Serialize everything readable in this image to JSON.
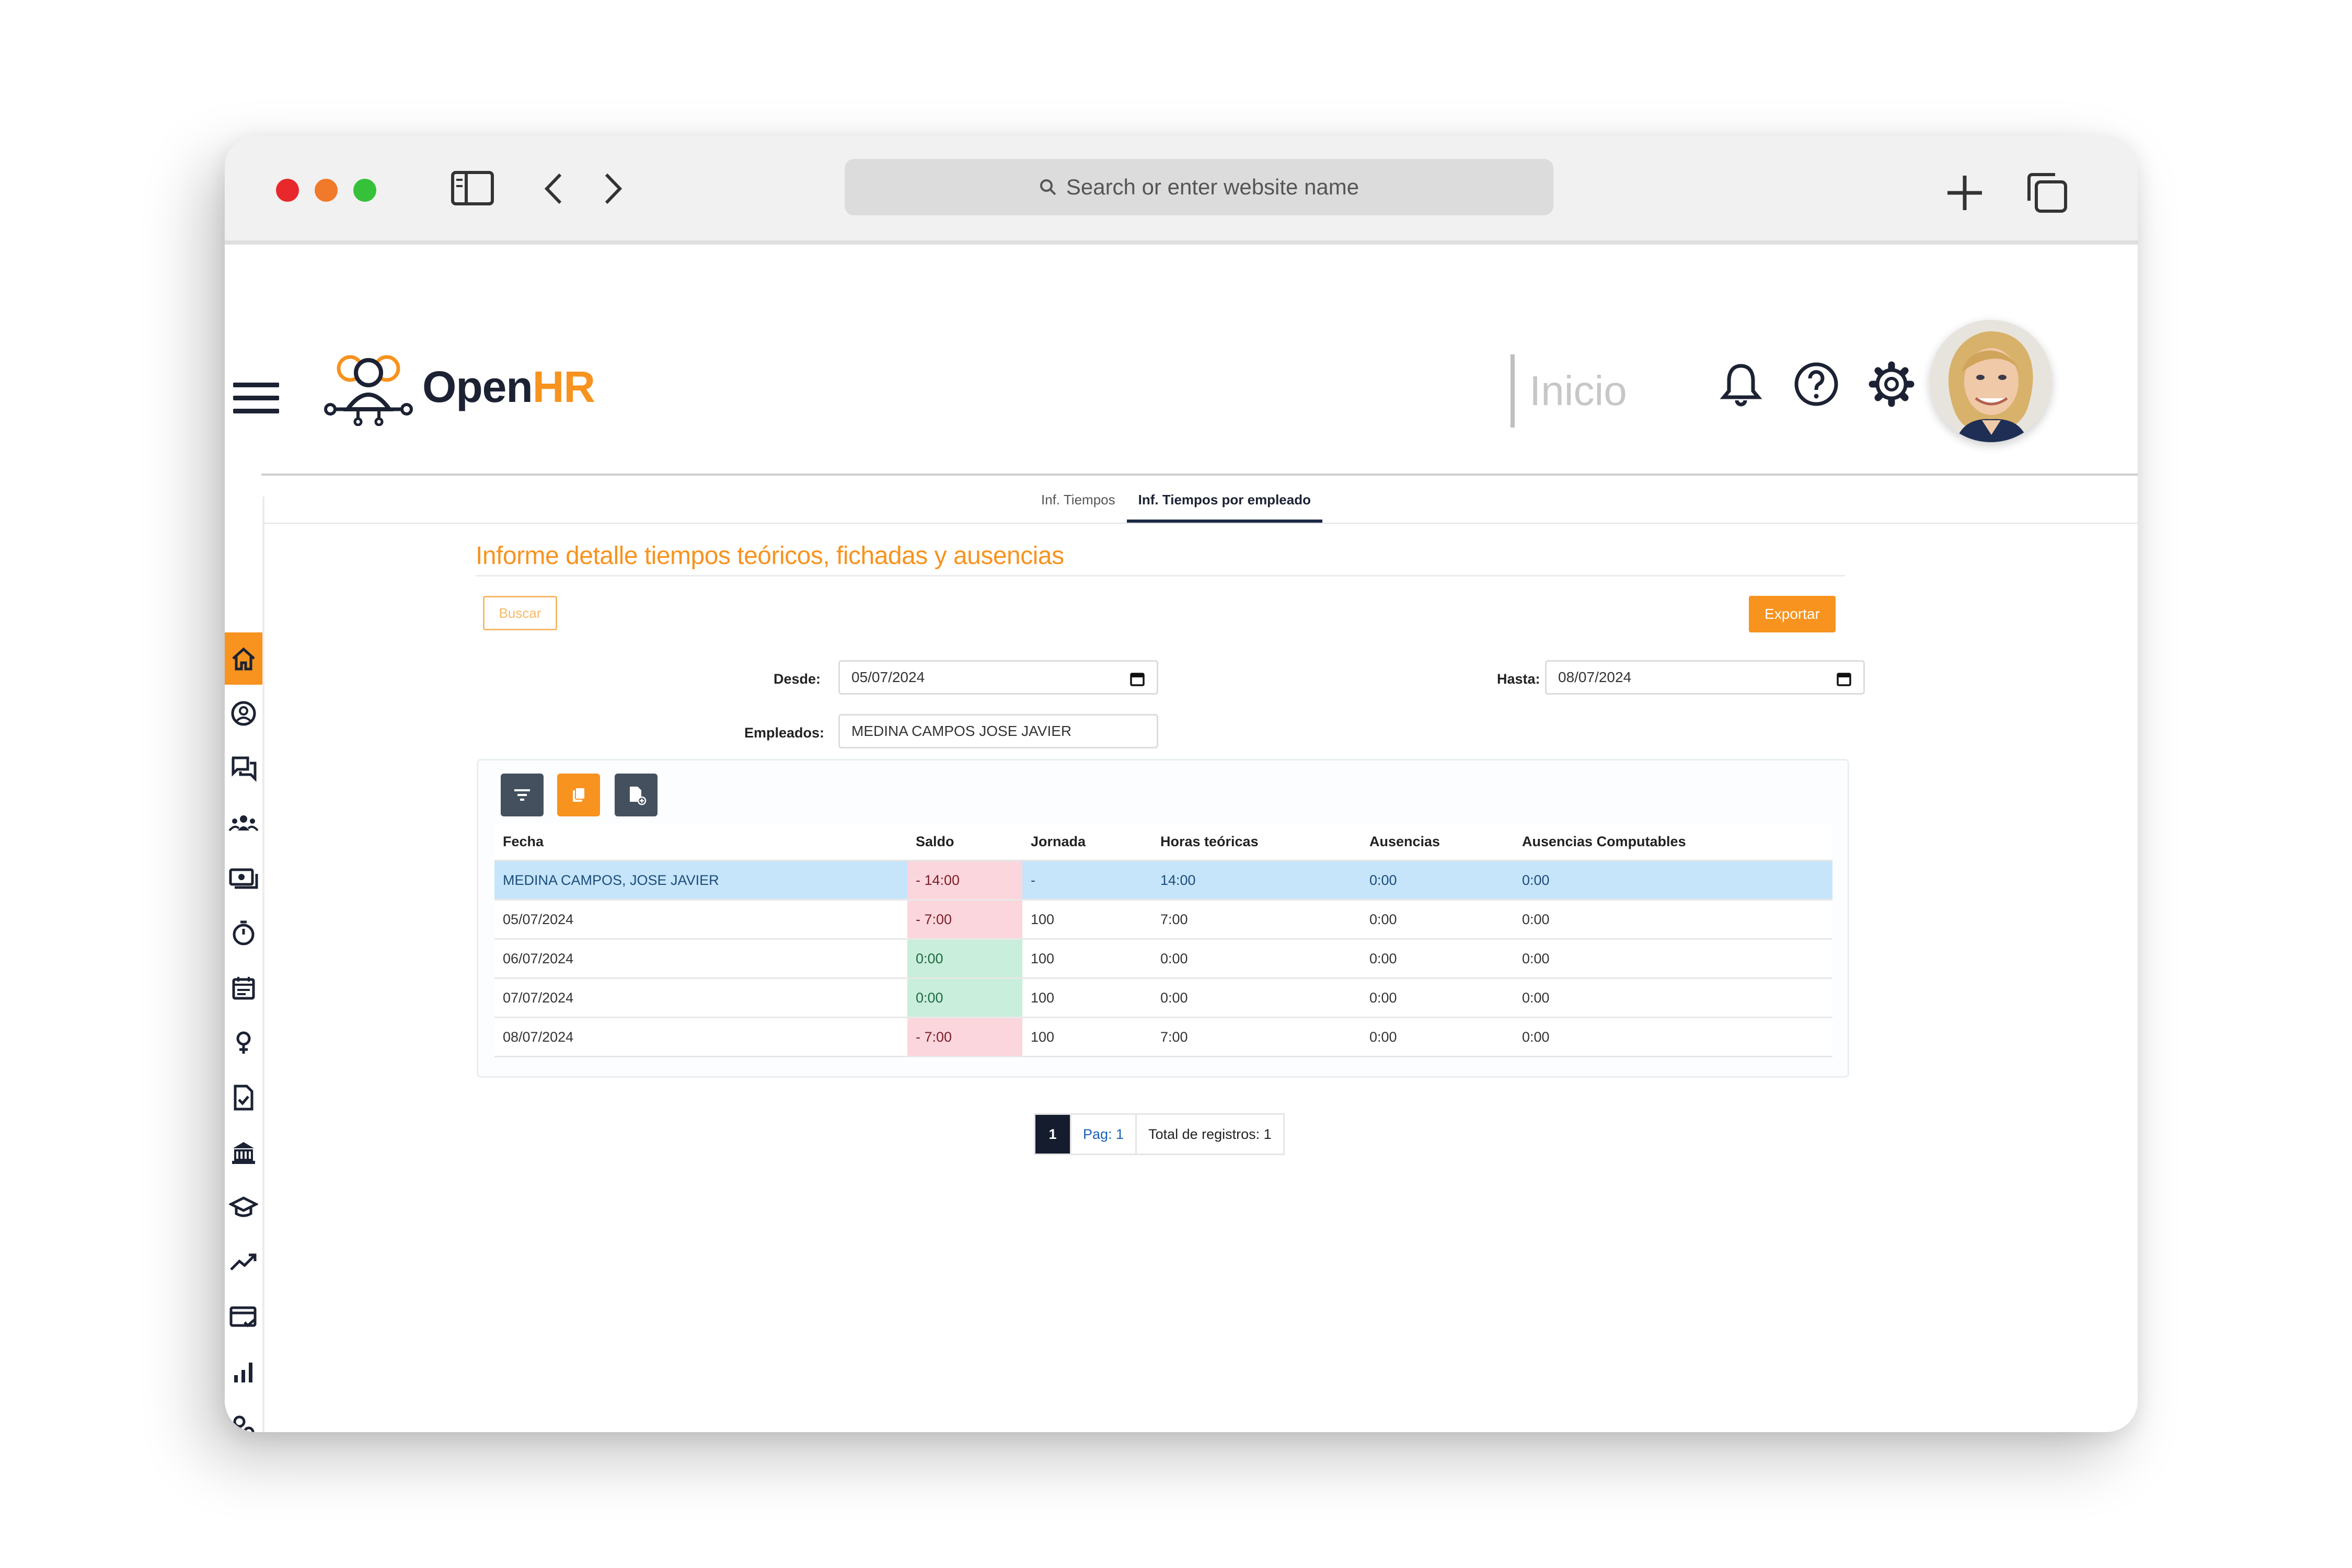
{
  "browser": {
    "url_placeholder": "Search or enter website name"
  },
  "header": {
    "logo_open": "Open",
    "logo_hr": "HR",
    "section": "Inicio"
  },
  "tabs": [
    {
      "label": "Inf. Tiempos",
      "active": false
    },
    {
      "label": "Inf. Tiempos por empleado",
      "active": true
    }
  ],
  "sidebar": {
    "items": [
      "home-icon",
      "user-circle-icon",
      "chat-icon",
      "team-icon",
      "payroll-icon",
      "timer-icon",
      "calendar-icon",
      "gender-icon",
      "document-check-icon",
      "building-icon",
      "graduation-icon",
      "trend-icon",
      "card-check-icon",
      "bar-chart-icon",
      "user-search-icon",
      "target-icon"
    ],
    "active_index": 0
  },
  "report": {
    "title": "Informe detalle tiempos teóricos, fichadas y ausencias",
    "buscar_label": "Buscar",
    "exportar_label": "Exportar",
    "desde_label": "Desde:",
    "desde_value": "05/07/2024",
    "hasta_label": "Hasta:",
    "hasta_value": "08/07/2024",
    "empleados_label": "Empleados:",
    "empleados_value": "MEDINA CAMPOS JOSE JAVIER"
  },
  "table": {
    "columns": [
      "Fecha",
      "Saldo",
      "Jornada",
      "Horas teóricas",
      "Ausencias",
      "Ausencias Computables"
    ],
    "summary": {
      "fecha": "MEDINA CAMPOS, JOSE JAVIER",
      "saldo": "- 14:00",
      "jornada": "-",
      "horas": "14:00",
      "ausencias": "0:00",
      "computables": "0:00"
    },
    "rows": [
      {
        "fecha": "05/07/2024",
        "saldo": "- 7:00",
        "jornada": "100",
        "horas": "7:00",
        "ausencias": "0:00",
        "computables": "0:00"
      },
      {
        "fecha": "06/07/2024",
        "saldo": "0:00",
        "jornada": "100",
        "horas": "0:00",
        "ausencias": "0:00",
        "computables": "0:00"
      },
      {
        "fecha": "07/07/2024",
        "saldo": "0:00",
        "jornada": "100",
        "horas": "0:00",
        "ausencias": "0:00",
        "computables": "0:00"
      },
      {
        "fecha": "08/07/2024",
        "saldo": "- 7:00",
        "jornada": "100",
        "horas": "7:00",
        "ausencias": "0:00",
        "computables": "0:00"
      }
    ]
  },
  "pager": {
    "current": "1",
    "page_label": "Pag: 1",
    "total_label": "Total de registros: 1"
  },
  "colors": {
    "accent": "#f7931e",
    "navy": "#1c2233",
    "negative": "#fbd6dc",
    "positive": "#c9eedb",
    "highlight": "#c6e5fb"
  }
}
